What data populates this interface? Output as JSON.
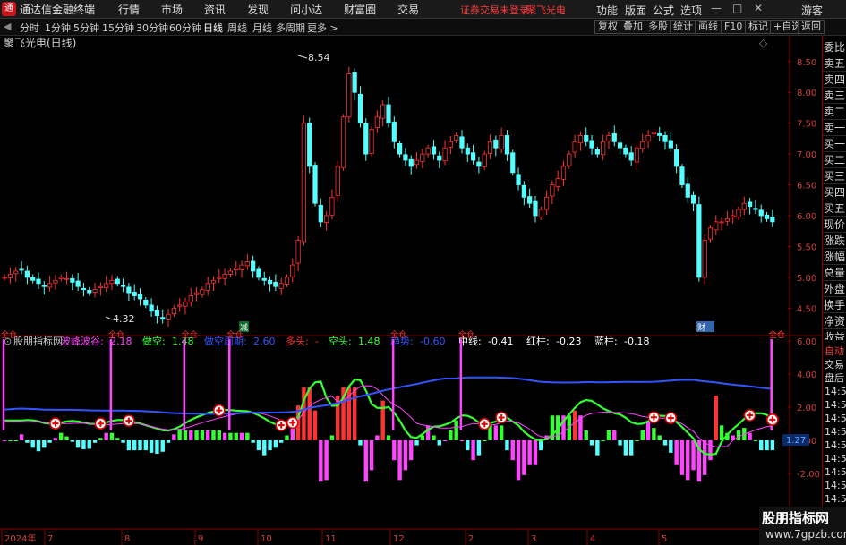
{
  "app": {
    "logo_text": "通",
    "title": "通达信金融终端"
  },
  "menu": [
    "行情",
    "市场",
    "资讯",
    "发现",
    "问小达",
    "财富圈",
    "交易"
  ],
  "login_text": "证券交易未登录",
  "stock_name_top": "聚飞光电",
  "right_menu": [
    "功能",
    "版面",
    "公式",
    "选项"
  ],
  "guest": "游客",
  "window_controls": [
    "—",
    "□",
    "✕"
  ],
  "periods": [
    "分时",
    "1分钟",
    "5分钟",
    "15分钟",
    "30分钟",
    "60分钟",
    "日线",
    "周线",
    "月线",
    "多周期",
    "更多 >"
  ],
  "active_period": "日线",
  "tool_buttons": [
    "复权",
    "叠加",
    "多股",
    "统计",
    "画线",
    "F10",
    "标记",
    "+自选",
    "返回"
  ],
  "price_panel": {
    "title": "聚飞光电(日线)",
    "high_label": "8.54",
    "low_label": "4.32",
    "badge_left": "减",
    "badge_right": "财",
    "y_ticks": [
      "8.50",
      "8.00",
      "7.50",
      "7.00",
      "6.50",
      "6.00",
      "5.50",
      "5.00",
      "4.50"
    ]
  },
  "indicator_panel": {
    "name": "股朋指标网",
    "items": [
      {
        "label": "波峰波谷:",
        "value": "2.18",
        "color": "#ff44ff"
      },
      {
        "label": "做空:",
        "value": "1.48",
        "color": "#33ff33"
      },
      {
        "label": "做空周期:",
        "value": "2.60",
        "color": "#3355ff"
      },
      {
        "label": "多头:",
        "value": "-",
        "color": "#ff3333"
      },
      {
        "label": "空头:",
        "value": "1.48",
        "color": "#33ff33"
      },
      {
        "label": "趋势:",
        "value": "-0.60",
        "color": "#3355ff"
      },
      {
        "label": "中线:",
        "value": "-0.41",
        "color": "#ffffff"
      },
      {
        "label": "红柱:",
        "value": "-0.23",
        "color": "#ffffff"
      },
      {
        "label": "蓝柱:",
        "value": "-0.18",
        "color": "#ffffff"
      }
    ],
    "y_ticks": [
      "6.00",
      "4.00",
      "2.00",
      "0.00",
      "-2.00"
    ],
    "current_value": "1.27",
    "signal_label": "全仓"
  },
  "x_axis": [
    "2024年",
    "7",
    "8",
    "9",
    "10",
    "11",
    "12",
    "2",
    "3",
    "4",
    "5"
  ],
  "side_panel_top": [
    "委比",
    "卖五",
    "卖四",
    "卖三",
    "卖二",
    "卖一",
    "买一",
    "买二",
    "买三",
    "买四",
    "买五",
    "现价",
    "涨跌",
    "涨幅",
    "总量",
    "外盘",
    "换手",
    "净资",
    "收益"
  ],
  "side_panel_bottom": [
    "自动",
    "交易",
    "盘后",
    "14:56",
    "14:56",
    "14:56",
    "14:56",
    "14:56",
    "14:56",
    "14:56",
    "14:56",
    "14:56"
  ],
  "watermark": {
    "cn": "股朋指标网",
    "url": "www.7gpzb.com"
  },
  "chart_data": {
    "type": "candlestick",
    "title": "聚飞光电(日线)",
    "price_range": [
      4.2,
      8.7
    ],
    "closes": [
      5.0,
      5.05,
      5.1,
      5.12,
      5.0,
      4.95,
      4.9,
      4.85,
      4.9,
      4.95,
      5.0,
      4.98,
      4.92,
      4.85,
      4.8,
      4.75,
      4.8,
      4.85,
      4.9,
      4.95,
      4.9,
      4.85,
      4.75,
      4.7,
      4.65,
      4.55,
      4.45,
      4.38,
      4.32,
      4.4,
      4.5,
      4.55,
      4.6,
      4.7,
      4.75,
      4.8,
      4.9,
      4.95,
      5.0,
      5.05,
      5.1,
      5.15,
      5.2,
      5.25,
      5.1,
      5.0,
      4.95,
      4.9,
      4.85,
      4.9,
      5.0,
      5.2,
      5.6,
      7.5,
      6.8,
      6.2,
      5.9,
      6.0,
      6.3,
      6.8,
      7.6,
      8.3,
      8.0,
      7.5,
      7.0,
      7.4,
      7.6,
      7.8,
      7.5,
      7.2,
      7.0,
      6.9,
      6.8,
      6.9,
      7.0,
      7.1,
      7.0,
      6.9,
      7.1,
      7.2,
      7.3,
      7.1,
      7.0,
      6.9,
      6.8,
      7.0,
      7.2,
      7.1,
      7.3,
      7.0,
      6.7,
      6.5,
      6.3,
      6.2,
      6.0,
      6.1,
      6.3,
      6.5,
      6.6,
      6.8,
      7.0,
      7.2,
      7.3,
      7.2,
      7.1,
      7.0,
      7.2,
      7.3,
      7.2,
      7.1,
      7.0,
      6.9,
      7.1,
      7.2,
      7.3,
      7.35,
      7.3,
      7.2,
      7.1,
      6.8,
      6.5,
      6.3,
      6.2,
      5.0,
      5.6,
      5.8,
      5.9,
      5.9,
      5.95,
      6.0,
      6.1,
      6.2,
      6.15,
      6.1,
      6.0,
      5.95,
      5.9
    ]
  }
}
